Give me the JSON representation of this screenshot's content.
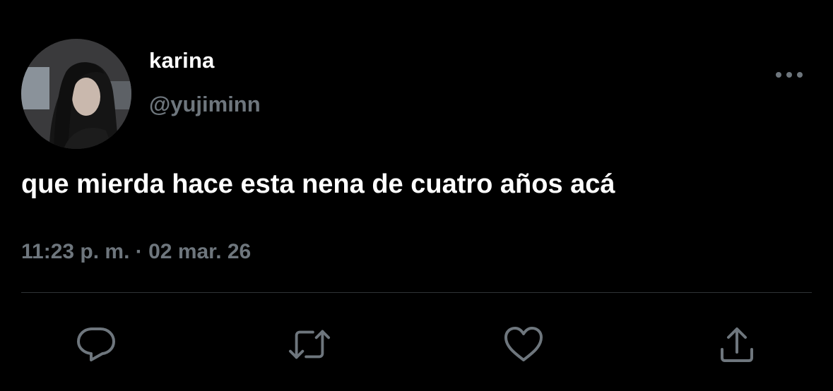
{
  "tweet": {
    "display_name": "karina",
    "handle": "@yujiminn",
    "text": "que mierda hace esta nena de cuatro años acá",
    "time": "11:23 p. m.",
    "separator": "·",
    "date": "02 mar. 26"
  },
  "icons": {
    "more": "more-horizontal-icon",
    "reply": "reply-bubble-icon",
    "retweet": "retweet-icon",
    "like": "heart-icon",
    "share": "share-upload-icon"
  },
  "colors": {
    "background": "#000000",
    "primary_text": "#ffffff",
    "secondary_text": "#6e767d",
    "divider": "#2f3336"
  }
}
